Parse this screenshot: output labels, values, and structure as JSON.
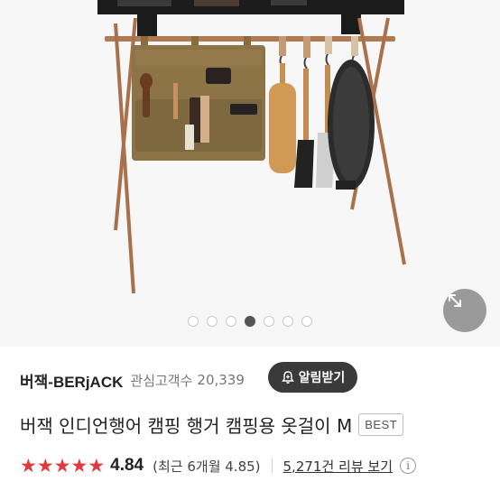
{
  "gallery": {
    "pages": 7,
    "active_index": 3
  },
  "brand": {
    "name": "버잭-BERjACK",
    "interest_label": "관심고객수",
    "interest_count": "20,339",
    "alarm_button": "알림받기"
  },
  "product": {
    "title": "버잭 인디언행어 캠핑 행거 캠핑용 옷걸이 M",
    "badge": "BEST"
  },
  "rating": {
    "stars": 5,
    "score": "4.84",
    "recent": "(최근 6개월 4.85)",
    "reviews": "5,271건 리뷰 보기",
    "info": "i"
  },
  "colors": {
    "star": "#e0393e",
    "active_dot": "#555555",
    "alarm_bg": "#3a3a3a",
    "expand_bg": "#9a9a9a"
  },
  "icons": {
    "expand": "expand-arrows-icon",
    "bell": "bell-plus-icon",
    "info": "info-circle-icon",
    "star": "star-icon"
  }
}
